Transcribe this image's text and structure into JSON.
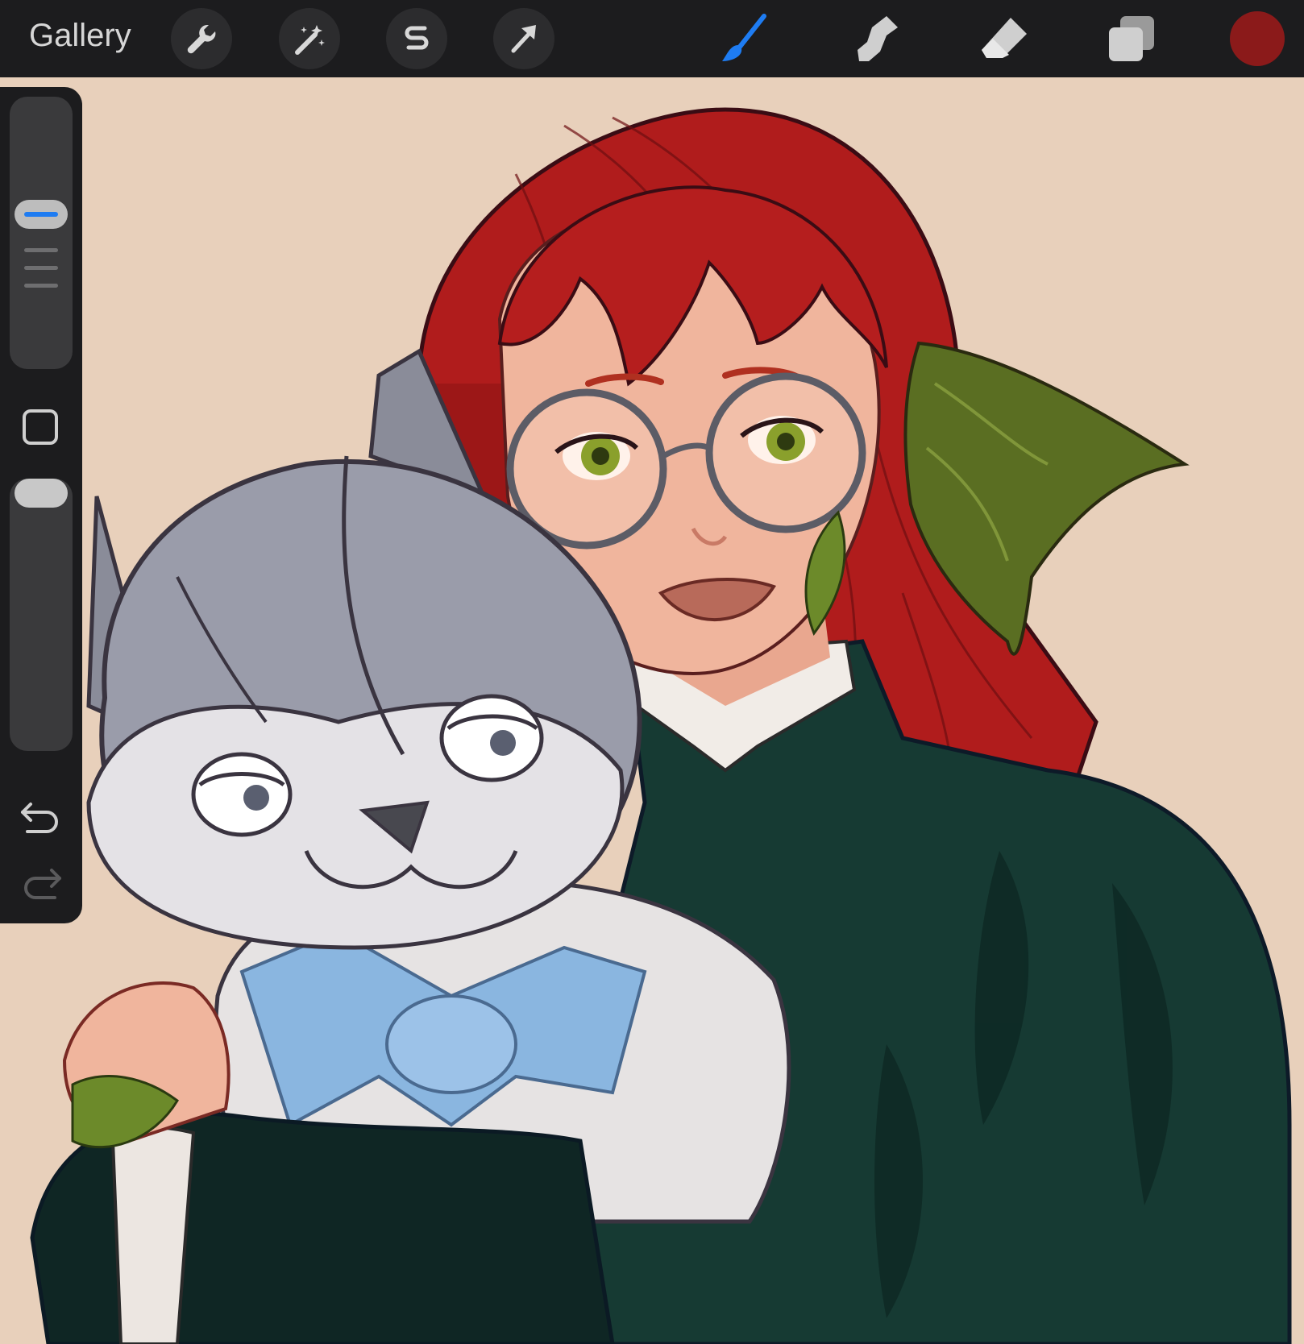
{
  "toolbar": {
    "gallery_label": "Gallery",
    "left_tools": [
      "wrench-icon",
      "magic-wand-icon",
      "selection-s-icon",
      "transform-arrow-icon"
    ],
    "right_tools": [
      "brush-icon",
      "smudge-icon",
      "eraser-icon",
      "layers-icon"
    ],
    "active_tool": "brush-icon",
    "active_color": "#8b1a1a",
    "accent_color": "#1e7cf2"
  },
  "sidebar": {
    "controls": [
      "brush-size-slider",
      "modify-square-button",
      "opacity-slider",
      "undo-icon",
      "redo-icon"
    ]
  },
  "canvas": {
    "background_color": "#e8d0bb"
  }
}
